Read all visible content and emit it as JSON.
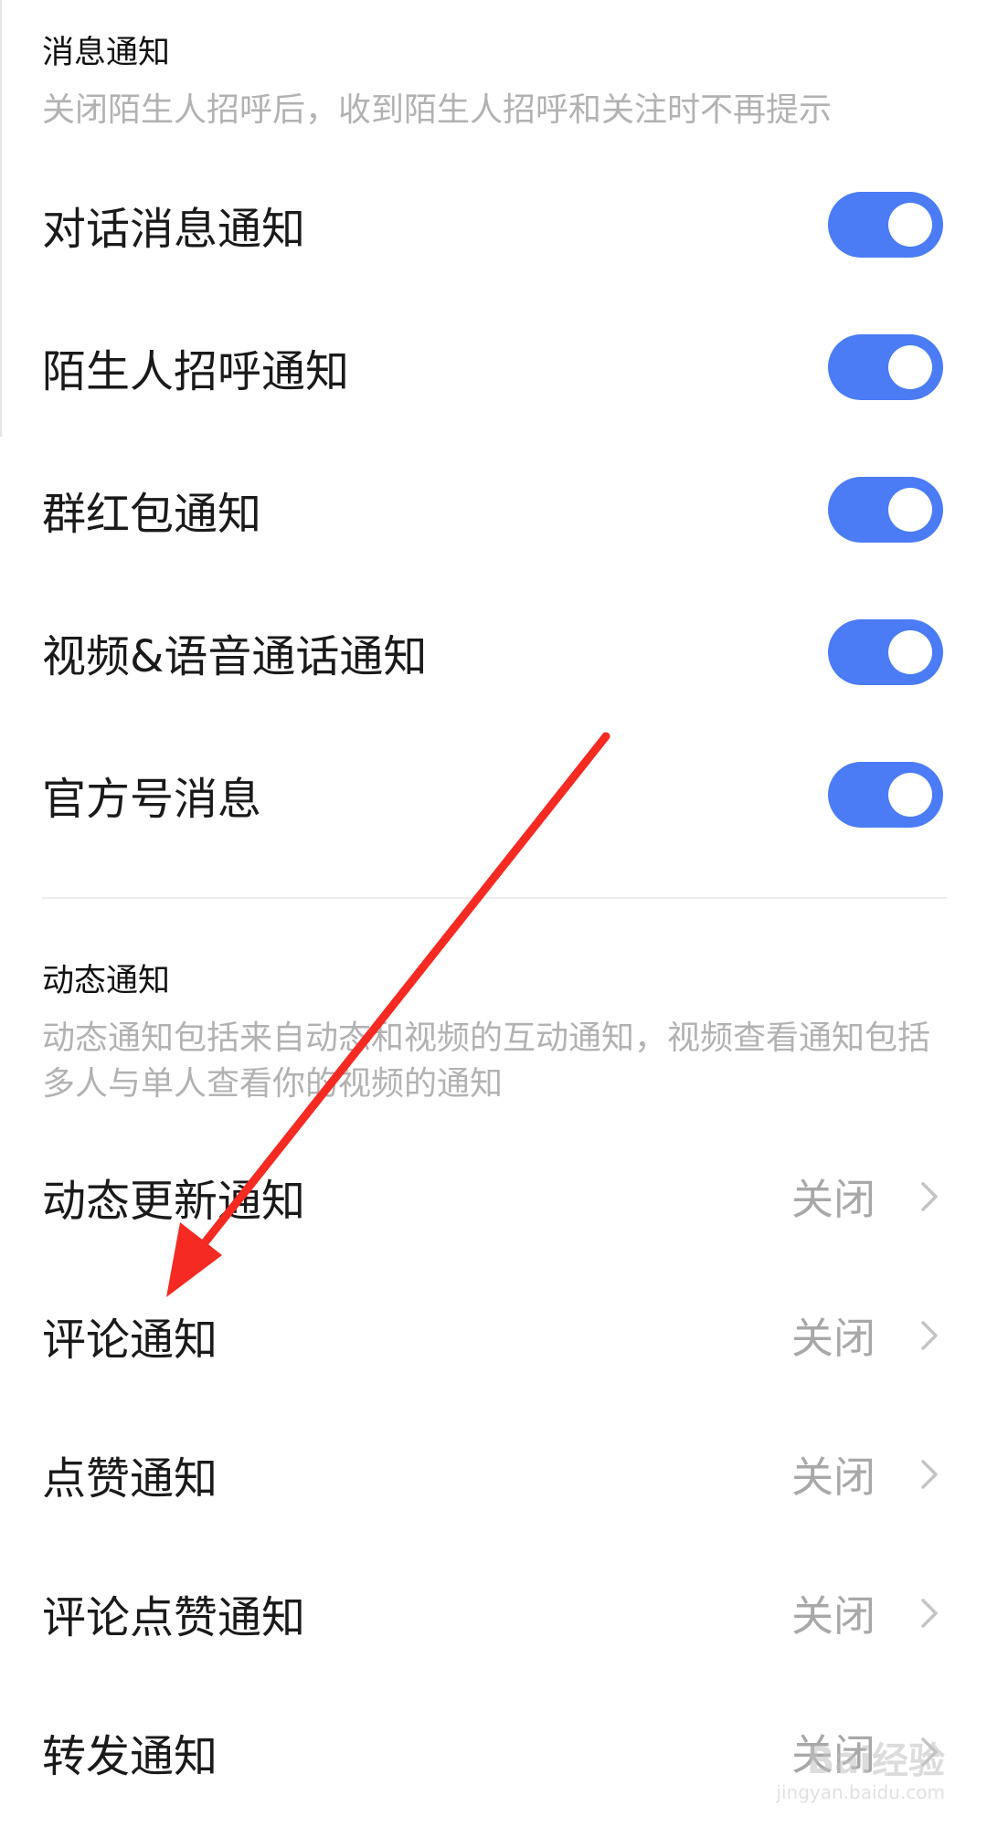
{
  "message_section": {
    "title": "消息通知",
    "description": "关闭陌生人招呼后，收到陌生人招呼和关注时不再提示",
    "items": [
      {
        "label": "对话消息通知",
        "enabled": true
      },
      {
        "label": "陌生人招呼通知",
        "enabled": true
      },
      {
        "label": "群红包通知",
        "enabled": true
      },
      {
        "label": "视频&语音通话通知",
        "enabled": true
      },
      {
        "label": "官方号消息",
        "enabled": true
      }
    ]
  },
  "feed_section": {
    "title": "动态通知",
    "description": "动态通知包括来自动态和视频的互动通知，视频查看通知包括多人与单人查看你的视频的通知",
    "items": [
      {
        "label": "动态更新通知",
        "value": "关闭"
      },
      {
        "label": "评论通知",
        "value": "关闭"
      },
      {
        "label": "点赞通知",
        "value": "关闭"
      },
      {
        "label": "评论点赞通知",
        "value": "关闭"
      },
      {
        "label": "转发通知",
        "value": "关闭"
      }
    ]
  },
  "colors": {
    "toggle_on": "#4b7cf5",
    "annotation_arrow": "#f52a22"
  },
  "icons": {
    "chevron": "chevron-right-icon",
    "annotation": "red-arrow-annotation"
  },
  "watermark": {
    "logo": "Bai经验",
    "url": "jingyan.baidu.com"
  }
}
